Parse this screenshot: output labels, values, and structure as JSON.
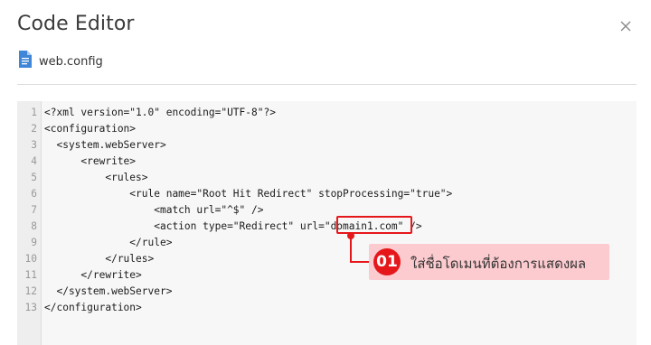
{
  "dialog": {
    "title": "Code Editor",
    "close_icon": "close-icon"
  },
  "file": {
    "icon": "document-icon",
    "name": "web.config"
  },
  "editor": {
    "lines": [
      {
        "num": "1",
        "code": "<?xml version=\"1.0\" encoding=\"UTF-8\"?>"
      },
      {
        "num": "2",
        "code": "<configuration>"
      },
      {
        "num": "3",
        "code": "  <system.webServer>"
      },
      {
        "num": "4",
        "code": "      <rewrite>"
      },
      {
        "num": "5",
        "code": "          <rules>"
      },
      {
        "num": "6",
        "code": "              <rule name=\"Root Hit Redirect\" stopProcessing=\"true\">"
      },
      {
        "num": "7",
        "code": "                  <match url=\"^$\" />"
      },
      {
        "num": "8",
        "code": "                  <action type=\"Redirect\" url=\"domain1.com\" />"
      },
      {
        "num": "9",
        "code": "              </rule>"
      },
      {
        "num": "10",
        "code": "          </rules>"
      },
      {
        "num": "11",
        "code": "      </rewrite>"
      },
      {
        "num": "12",
        "code": "  </system.webServer>"
      },
      {
        "num": "13",
        "code": "</configuration>"
      }
    ]
  },
  "callout": {
    "number": "01",
    "text": "ใส่ชื่อโดเมนที่ต้องการแสดงผล",
    "color": "#e5171b",
    "label_bg": "#fccbcf"
  }
}
